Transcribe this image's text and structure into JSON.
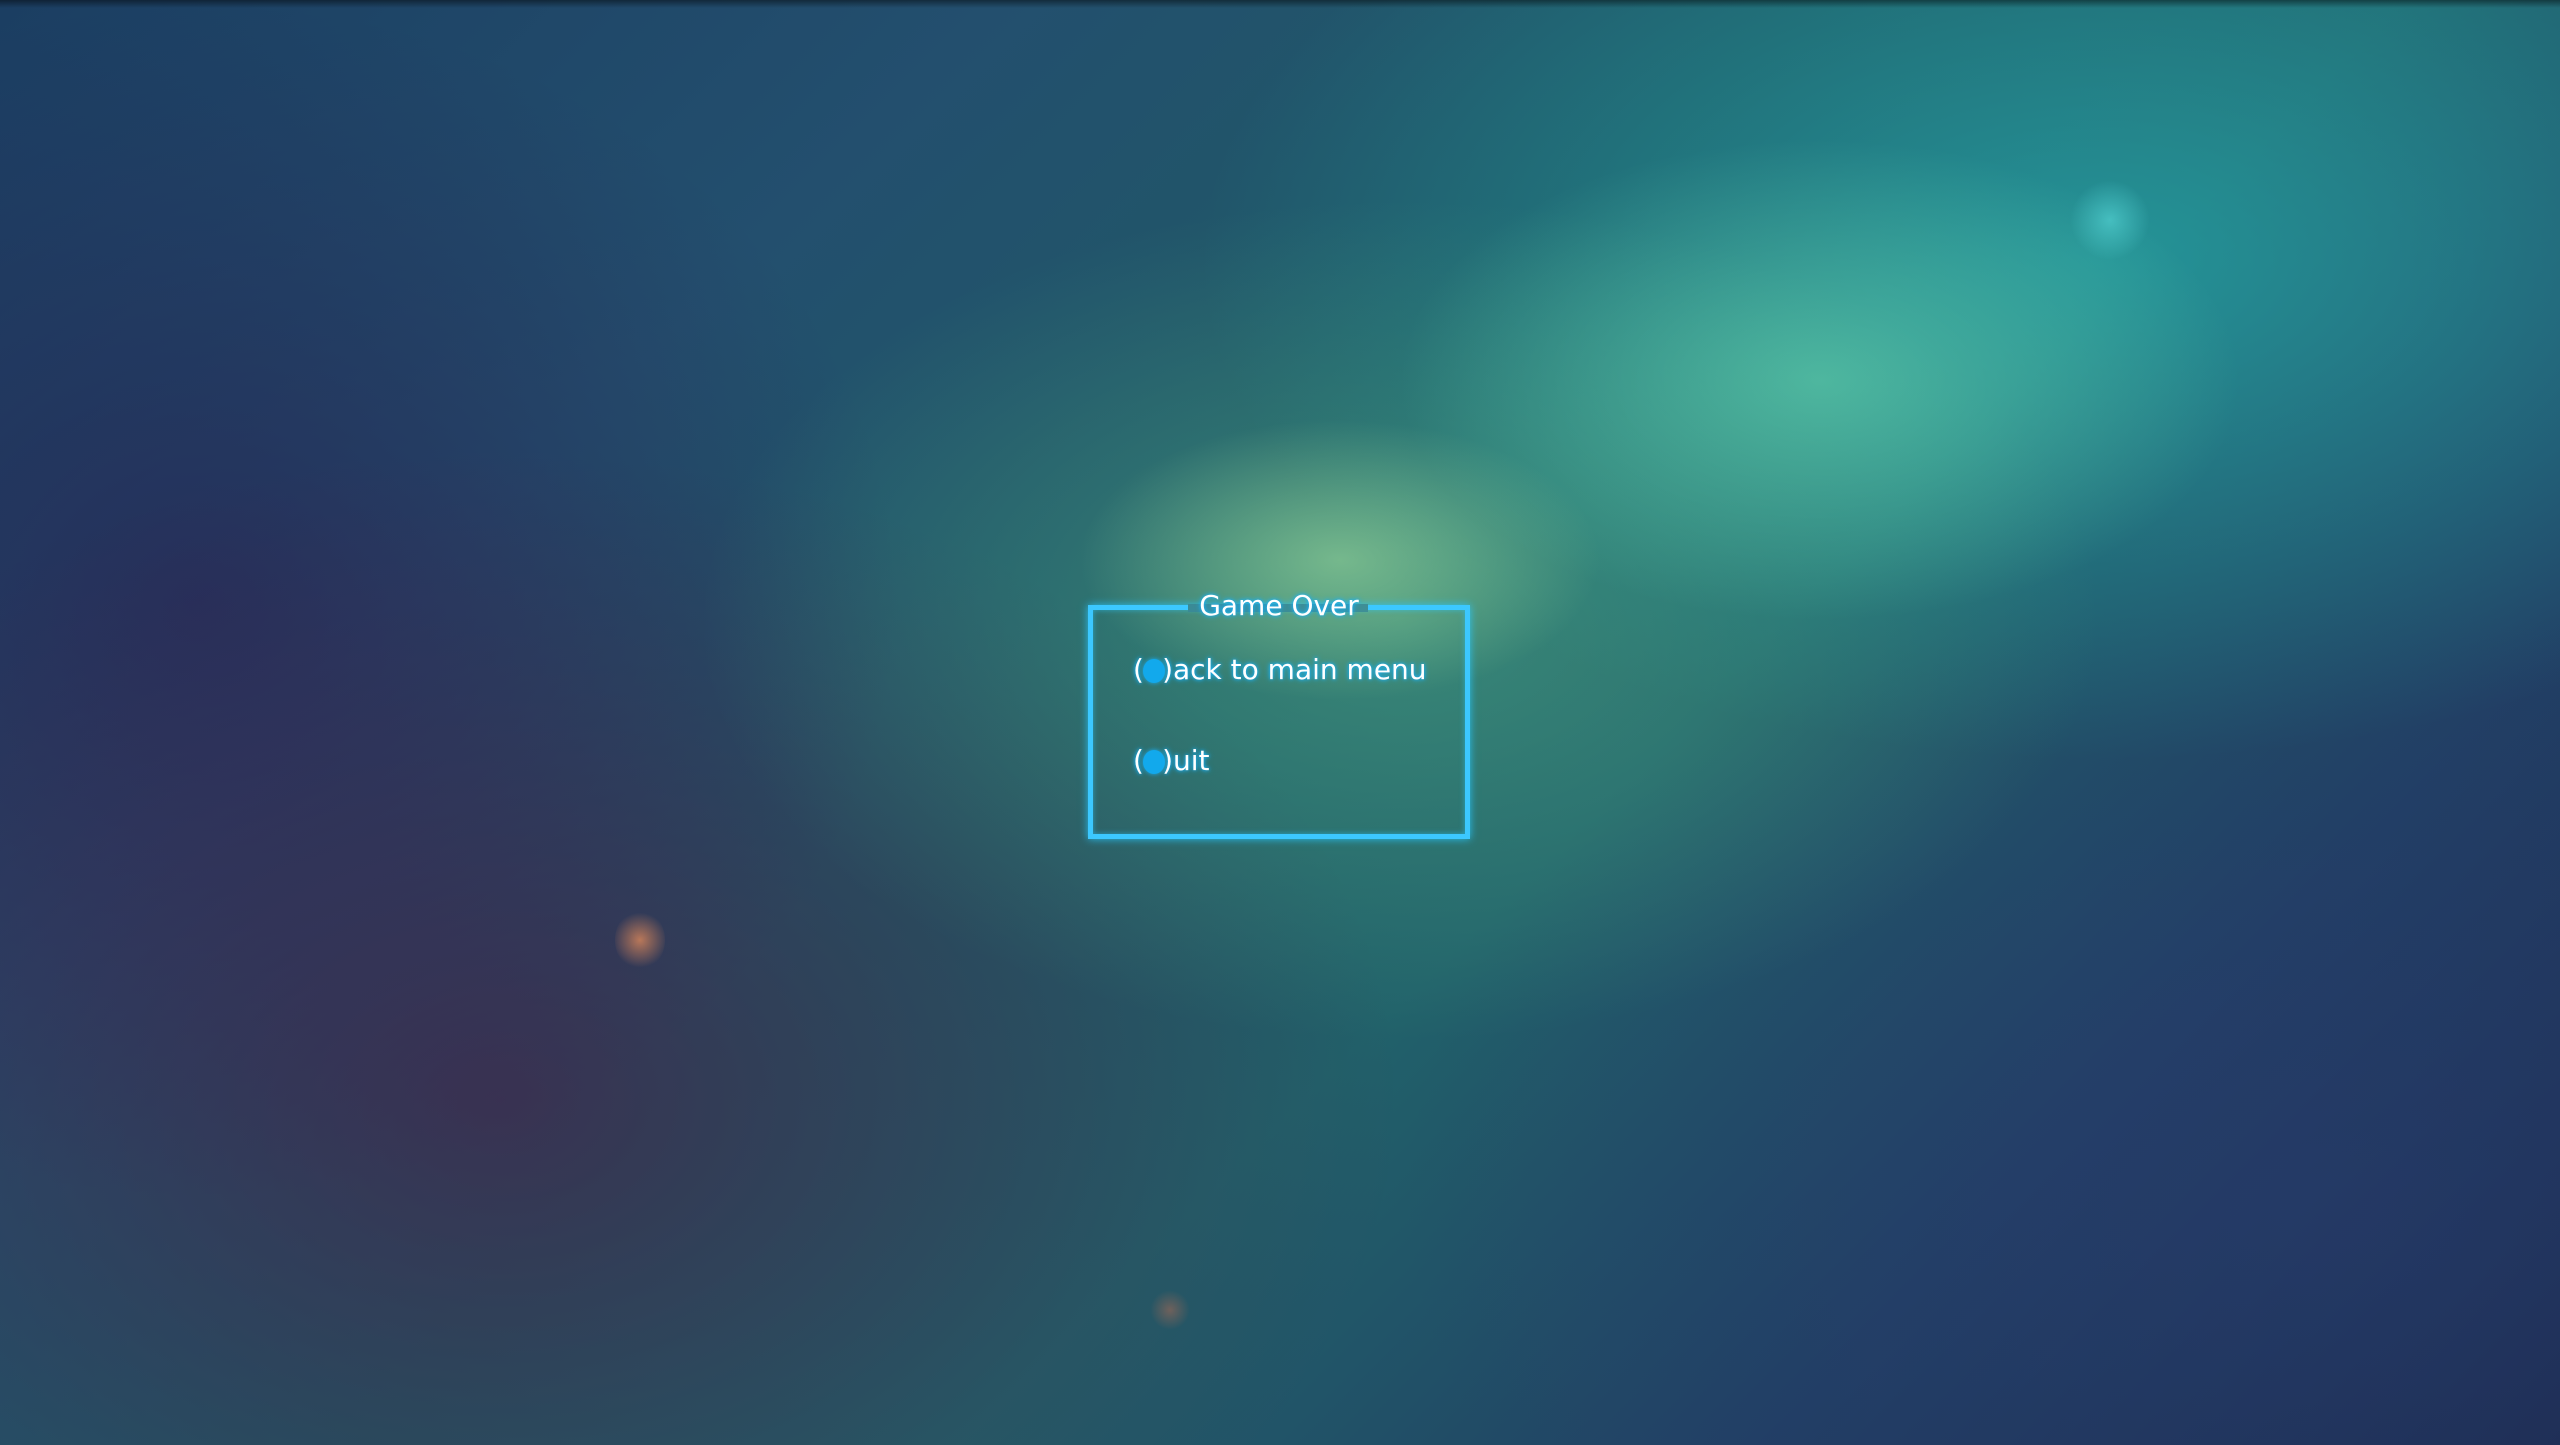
{
  "dialog": {
    "title": "Game Over",
    "border_color": "#3cc8ff"
  },
  "menu": {
    "items": [
      {
        "prefix_open": "(",
        "prefix_close": ")",
        "controller_button_icon": "gamepad-button-icon",
        "label": "ack to main menu"
      },
      {
        "prefix_open": "(",
        "prefix_close": ")",
        "controller_button_icon": "gamepad-button-icon",
        "label": "uit"
      }
    ]
  },
  "colors": {
    "accent": "#1ab0f5",
    "text": "#ffffff"
  }
}
